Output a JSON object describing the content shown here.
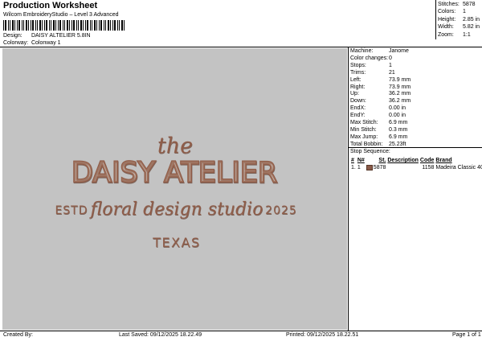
{
  "header": {
    "title": "Production Worksheet",
    "subtitle": "Wilcom EmbroideryStudio – Level 3 Advanced",
    "design_label": "Design:",
    "design_value": "DAISY ALTELIER 5.8IN",
    "colorway_label": "Colorway:",
    "colorway_value": "Colonway 1"
  },
  "summary": [
    {
      "label": "Stitches:",
      "value": "5878"
    },
    {
      "label": "Colors:",
      "value": "1"
    },
    {
      "label": "Height:",
      "value": "2.85 in"
    },
    {
      "label": "Width:",
      "value": "5.82 in"
    },
    {
      "label": "Zoom:",
      "value": "1:1"
    }
  ],
  "machine_info": [
    {
      "label": "Machine:",
      "value": "Janome"
    },
    {
      "label": "Color changes:",
      "value": "0"
    },
    {
      "label": "Stops:",
      "value": "1"
    },
    {
      "label": "Trims:",
      "value": "21"
    },
    {
      "label": "Left:",
      "value": "73.9 mm"
    },
    {
      "label": "Right:",
      "value": "73.9 mm"
    },
    {
      "label": "Up:",
      "value": "36.2 mm"
    },
    {
      "label": "Down:",
      "value": "36.2 mm"
    },
    {
      "label": "EndX:",
      "value": "0.00 in"
    },
    {
      "label": "EndY:",
      "value": "0.00 in"
    },
    {
      "label": "Max Stitch:",
      "value": "6.9 mm"
    },
    {
      "label": "Min Stitch:",
      "value": "0.3 mm"
    },
    {
      "label": "Max Jump:",
      "value": "6.9 mm"
    },
    {
      "label": "Total Bobbin:",
      "value": "25.23ft"
    }
  ],
  "stop_sequence": {
    "title": "Stop Sequence:",
    "headers": [
      "#",
      "N#",
      "",
      "St.",
      "Description",
      "Code",
      "Brand"
    ],
    "rows": [
      {
        "num": "1.",
        "n": "1",
        "swatch_color": "#8a5a48",
        "stitches": "5878",
        "description": "",
        "code": "1158",
        "brand": "Madeira Classic 40"
      }
    ]
  },
  "design_art": {
    "line1": "the",
    "line2": "DAISY ATELIER",
    "estd": "ESTD",
    "tagline": "floral design studio",
    "year": "2025",
    "location": "TEXAS",
    "thread_color": "#8f5d4a",
    "shadow_color": "#5e3a2d",
    "highlight_color": "#c49a84",
    "background_color": "#c3c3c3"
  },
  "footer": {
    "created_by": "Created By:",
    "last_saved": "Last Saved: 09/12/2025 18.22.49",
    "printed": "Printed: 09/12/2025 18.22.51",
    "page": "Page 1 of 1"
  }
}
